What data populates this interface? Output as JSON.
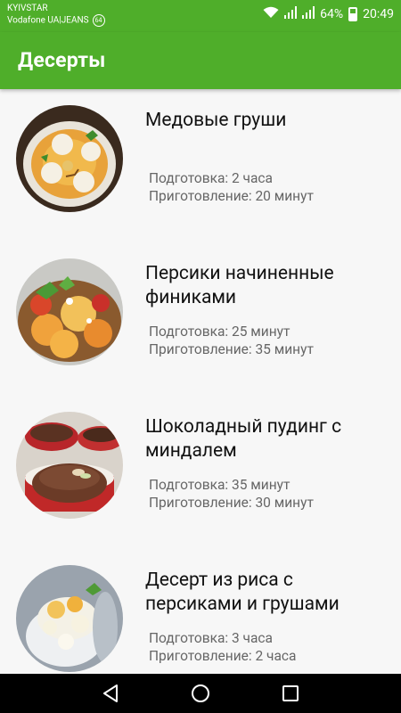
{
  "status_bar": {
    "carrier_line1": "KYIVSTAR",
    "carrier_line2": "Vodafone UA|JEANS",
    "carrier_badge": "64",
    "battery": "64%",
    "time": "20:49"
  },
  "app_bar": {
    "title": "Десерты"
  },
  "items": [
    {
      "title": "Медовые груши",
      "prep": "Подготовка: 2 часа",
      "cook": "Приготовление: 20 минут",
      "image": "honey-pears-photo"
    },
    {
      "title": "Персики начиненные финиками",
      "prep": "Подготовка: 25 минут",
      "cook": "Приготовление: 35 минут",
      "image": "stuffed-peaches-photo"
    },
    {
      "title": "Шоколадный пудинг с миндалем",
      "prep": "Подготовка: 35 минут",
      "cook": "Приготовление: 30 минут",
      "image": "chocolate-pudding-photo"
    },
    {
      "title": "Десерт из риса с персиками и грушами",
      "prep": "Подготовка: 3 часа",
      "cook": "Приготовление: 2 часа",
      "image": "rice-dessert-photo"
    }
  ],
  "nav_bar": {
    "icons": [
      "back-icon",
      "home-icon",
      "recent-apps-icon"
    ]
  },
  "colors": {
    "primary": "#4fae2a",
    "navbar": "#000000",
    "background": "#f7f7f7"
  }
}
